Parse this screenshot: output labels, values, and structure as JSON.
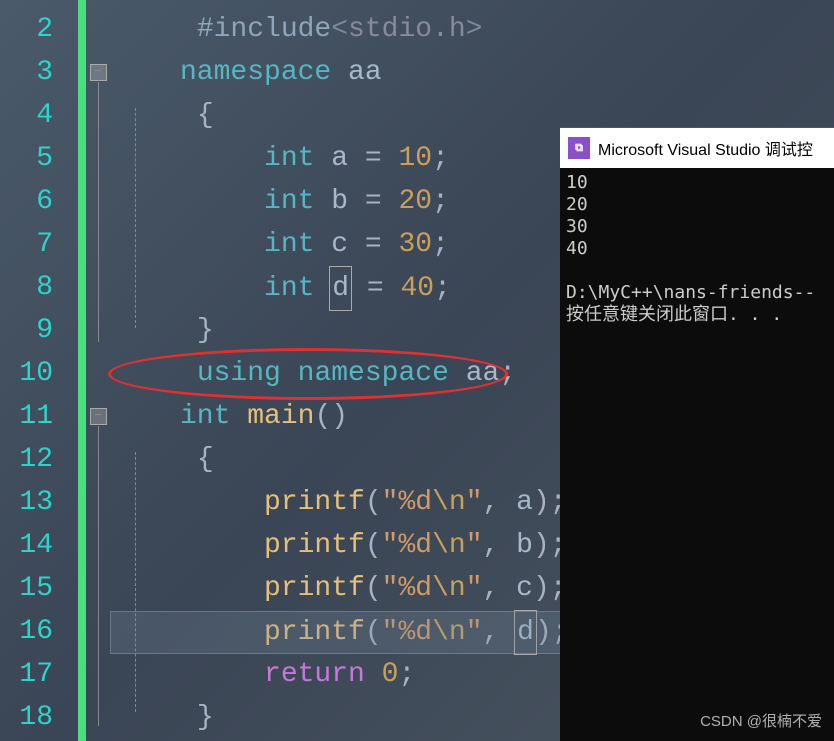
{
  "editor": {
    "lines": {
      "start": 2,
      "end": 18
    },
    "fold_markers": [
      {
        "line": 3,
        "symbol": "⊟"
      },
      {
        "line": 11,
        "symbol": "⊟"
      }
    ],
    "code": {
      "l2": {
        "include": "#include",
        "open": "<",
        "path": "stdio.h",
        "close": ">"
      },
      "l3": {
        "ns_kw": "namespace",
        "ns_name": "aa"
      },
      "l4": {
        "brace": "{"
      },
      "l5": {
        "type": "int",
        "var": "a",
        "eq": "=",
        "val": "10",
        "semi": ";"
      },
      "l6": {
        "type": "int",
        "var": "b",
        "eq": "=",
        "val": "20",
        "semi": ";"
      },
      "l7": {
        "type": "int",
        "var": "c",
        "eq": "=",
        "val": "30",
        "semi": ";"
      },
      "l8": {
        "type": "int",
        "var": "d",
        "eq": "=",
        "val": "40",
        "semi": ";"
      },
      "l9": {
        "brace": "}"
      },
      "l10": {
        "using": "using",
        "ns_kw": "namespace",
        "ns_name": "aa",
        "semi": ";"
      },
      "l11": {
        "type": "int",
        "func": "main",
        "parens": "()"
      },
      "l12": {
        "brace": "{"
      },
      "l13": {
        "func": "printf",
        "open": "(",
        "str": "\"%d",
        "esc": "\\n",
        "strend": "\"",
        "comma": ",",
        "var": "a",
        "close": ")",
        "semi": ";"
      },
      "l14": {
        "func": "printf",
        "open": "(",
        "str": "\"%d",
        "esc": "\\n",
        "strend": "\"",
        "comma": ",",
        "var": "b",
        "close": ")",
        "semi": ";"
      },
      "l15": {
        "func": "printf",
        "open": "(",
        "str": "\"%d",
        "esc": "\\n",
        "strend": "\"",
        "comma": ",",
        "var": "c",
        "close": ")",
        "semi": ";"
      },
      "l16": {
        "func": "printf",
        "open": "(",
        "str": "\"%d",
        "esc": "\\n",
        "strend": "\"",
        "comma": ",",
        "var": "d",
        "close": ")",
        "semi": ";"
      },
      "l17": {
        "ret": "return",
        "val": "0",
        "semi": ";"
      },
      "l18": {
        "brace": "}"
      }
    }
  },
  "console": {
    "title": "Microsoft Visual Studio 调试控",
    "output": "10\n20\n30\n40\n\nD:\\MyC++\\nans-friends--\n按任意键关闭此窗口. . ."
  },
  "watermark": "CSDN @很楠不爱"
}
